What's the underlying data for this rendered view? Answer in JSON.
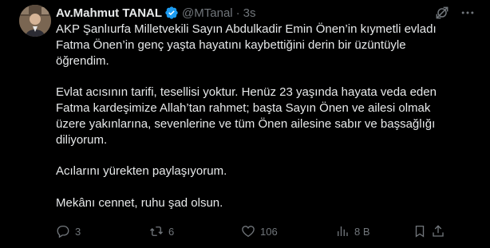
{
  "author": {
    "display_name": "Av.Mahmut TANAL",
    "handle": "@MTanal",
    "separator": "·",
    "time": "3s"
  },
  "body": {
    "paragraphs": [
      "AKP Şanlıurfa Milletvekili Sayın Abdulkadir Emin Önen’in kıymetli evladı\nFatma Önen’in genç yaşta hayatını kaybettiğini derin bir üzüntüyle\nöğrendim.",
      "Evlat acısının tarifi, tesellisi yoktur. Henüz 23 yaşında hayata veda eden\nFatma kardeşimize Allah’tan rahmet; başta Sayın Önen ve ailesi olmak\nüzere yakınlarına, sevenlerine ve tüm Önen ailesine sabır ve başsağlığı\ndiliyorum.",
      "Acılarını yürekten paylaşıyorum.",
      "Mekânı cennet, ruhu şad olsun."
    ]
  },
  "actions": {
    "replies": "3",
    "reposts": "6",
    "likes": "106",
    "views": "8 B"
  },
  "icons": {
    "verified": "verified-badge-icon",
    "grok": "grok-icon",
    "more": "more-icon",
    "reply": "reply-icon",
    "repost": "repost-icon",
    "like": "heart-icon",
    "views": "views-icon",
    "bookmark": "bookmark-icon",
    "share": "share-icon"
  },
  "colors": {
    "background": "#000000",
    "text": "#e7e9ea",
    "muted": "#71767b",
    "verified": "#1d9bf0"
  }
}
